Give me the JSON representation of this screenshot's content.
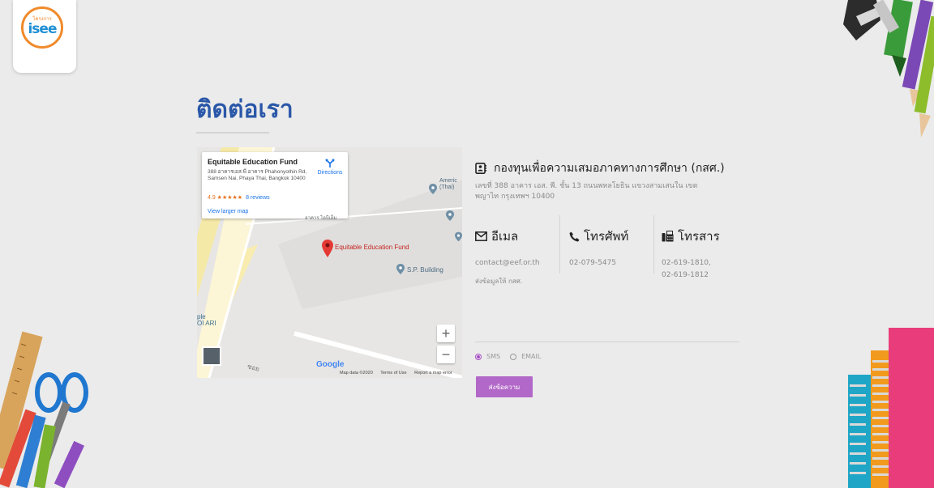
{
  "logo": {
    "small_text": "โครงการ",
    "text": "isee"
  },
  "page": {
    "title": "ติดต่อเรา"
  },
  "map": {
    "card": {
      "title": "Equitable Education Fund",
      "address": "388 อาคารเอส.พี อาคาร Phahonyothin Rd, Samsen Nai, Phaya Thai, Bangkok 10400",
      "rating": "4.9 ★★★★★",
      "reviews": "8 reviews",
      "directions": "Directions",
      "larger_map": "View larger map"
    },
    "labels": {
      "main_pin": "Equitable Education Fund",
      "sp_building": "S.P. Building",
      "america": "Americ",
      "thai": "(Thai)",
      "ari": "ple\nOI ARI",
      "road": "อาคาร ไอบีเอ็ม",
      "soi": "ซอย"
    },
    "zoom_in": "+",
    "zoom_out": "−",
    "google": "Google",
    "footer": {
      "data": "Map data ©2020",
      "terms": "Terms of Use",
      "report": "Report a map error"
    }
  },
  "contact": {
    "org_name": "กองทุนเพื่อความเสมอภาคทางการศึกษา (กสศ.)",
    "address": "เลขที่ 388 อาคาร เอส. พี. ชั้น 13 ถนนพหลโยธิน แขวงสามเสนใน เขตพญาไท กรุงเทพฯ 10400",
    "email": {
      "label": "อีเมล",
      "value": "contact@eef.or.th"
    },
    "phone": {
      "label": "โทรศัพท์",
      "value": "02-079-5475"
    },
    "fax": {
      "label": "โทรสาร",
      "value1": "02-619-1810,",
      "value2": "02-619-1812"
    },
    "send_info": "ส่งข้อมูลให้ กสศ."
  },
  "form": {
    "options": [
      "SMS",
      "EMAIL"
    ],
    "selected": "SMS",
    "submit": "ส่งข้อความ"
  },
  "colors": {
    "title": "#2a57a8",
    "accent": "#b268c8",
    "logo_orange": "#f08a2b",
    "logo_blue": "#1f8fd3"
  }
}
